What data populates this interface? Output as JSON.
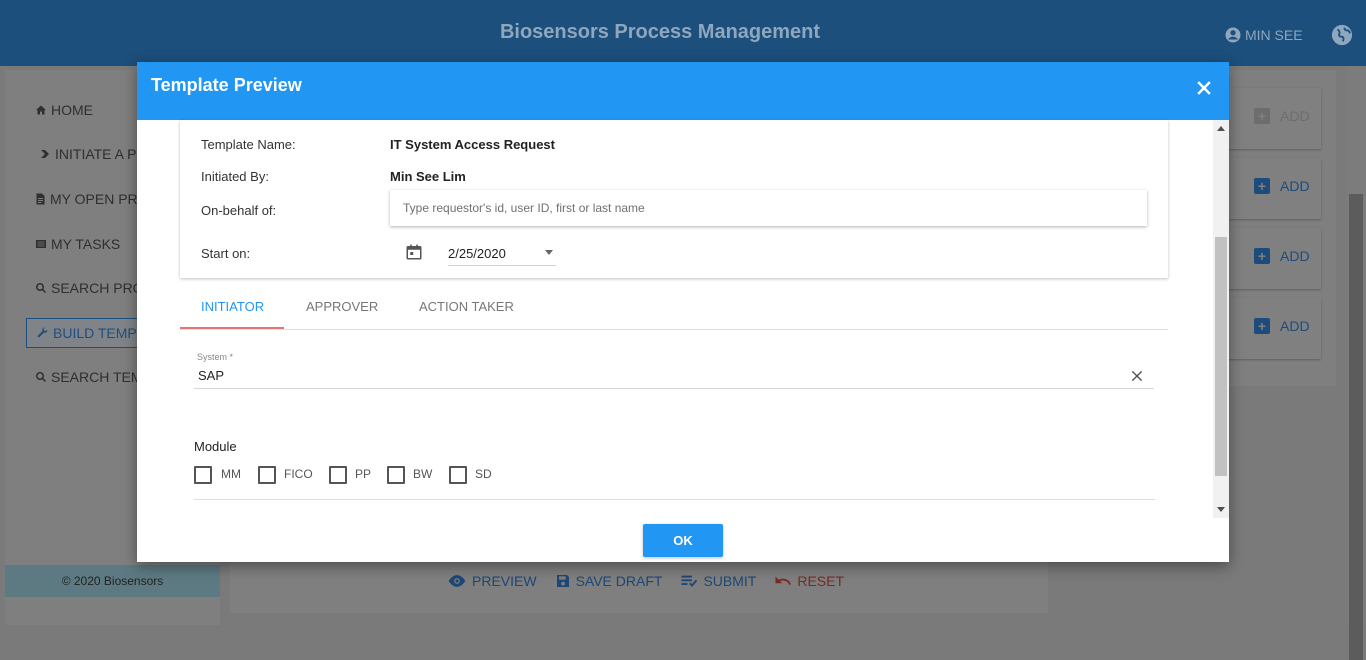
{
  "app": {
    "title": "Biosensors Process Management",
    "user_name": "MIN SEE"
  },
  "sidebar": {
    "items": [
      {
        "label": "HOME",
        "icon": "home-icon"
      },
      {
        "label": "INITIATE A PR",
        "icon": "chevron-right-icon"
      },
      {
        "label": "MY OPEN PRO",
        "icon": "document-icon"
      },
      {
        "label": "MY TASKS",
        "icon": "list-icon"
      },
      {
        "label": "SEARCH PRO",
        "icon": "search-icon"
      },
      {
        "label": "BUILD TEMPLA",
        "icon": "wrench-icon"
      },
      {
        "label": "SEARCH TEMI",
        "icon": "search-icon"
      }
    ],
    "footer": "© 2020 Biosensors"
  },
  "actions": {
    "preview": "PREVIEW",
    "save_draft": "SAVE DRAFT",
    "submit": "SUBMIT",
    "reset": "RESET"
  },
  "right_panel": {
    "add_labels": [
      "ADD",
      "ADD",
      "ADD",
      "ADD"
    ]
  },
  "modal": {
    "title": "Template Preview",
    "labels": {
      "template_name": "Template Name:",
      "initiated_by": "Initiated By:",
      "on_behalf": "On-behalf of:",
      "start_on": "Start on:"
    },
    "template_name": "IT System Access Request",
    "initiated_by": "Min See Lim",
    "on_behalf_placeholder": "Type requestor's id, user ID, first or last name",
    "start_date": "2/25/2020",
    "tabs": [
      "INITIATOR",
      "APPROVER",
      "ACTION TAKER"
    ],
    "system_label": "System *",
    "system_value": "SAP",
    "module_label": "Module",
    "modules": [
      "MM",
      "FICO",
      "PP",
      "BW",
      "SD"
    ],
    "ok": "OK"
  },
  "colors": {
    "header": "#2196f3",
    "app_bar": "#1c4f7c",
    "active_tab": "#2196f3",
    "tab_underline": "#e57373"
  }
}
